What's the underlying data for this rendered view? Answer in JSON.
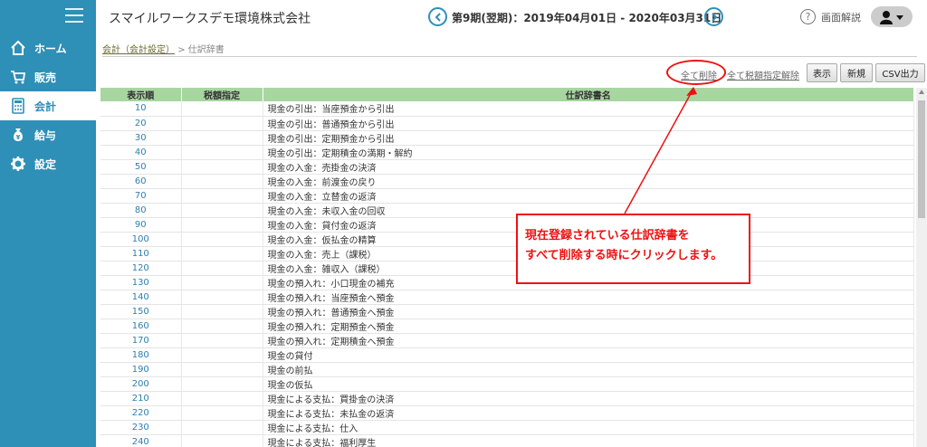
{
  "sidebar": {
    "items": [
      {
        "label": "ホーム",
        "icon": "home-icon"
      },
      {
        "label": "販売",
        "icon": "cart-icon"
      },
      {
        "label": "会計",
        "icon": "calculator-icon",
        "active": true
      },
      {
        "label": "給与",
        "icon": "money-bag-icon"
      },
      {
        "label": "設定",
        "icon": "gear-icon"
      }
    ]
  },
  "header": {
    "company": "スマイルワークスデモ環境株式会社",
    "period": "第9期(翌期)：2019年04月01日 - 2020年03月31日",
    "help_label": "画面解説",
    "help_icon": "?"
  },
  "breadcrumb": {
    "parent": "会計（会計設定）",
    "separator": ">",
    "current": "仕訳辞書"
  },
  "toolbar": {
    "delete_all": "全て削除",
    "clear_tax": "全て税額指定解除",
    "show_button": "表示",
    "new_button": "新規",
    "csv_button": "CSV出力"
  },
  "table": {
    "headers": [
      "表示順",
      "税額指定",
      "仕訳辞書名"
    ],
    "rows": [
      {
        "order": "10",
        "tax": "",
        "name": "現金の引出：当座預金から引出"
      },
      {
        "order": "20",
        "tax": "",
        "name": "現金の引出：普通預金から引出"
      },
      {
        "order": "30",
        "tax": "",
        "name": "現金の引出：定期預金から引出"
      },
      {
        "order": "40",
        "tax": "",
        "name": "現金の引出：定期積金の満期・解約"
      },
      {
        "order": "50",
        "tax": "",
        "name": "現金の入金：売掛金の決済"
      },
      {
        "order": "60",
        "tax": "",
        "name": "現金の入金：前渡金の戻り"
      },
      {
        "order": "70",
        "tax": "",
        "name": "現金の入金：立替金の返済"
      },
      {
        "order": "80",
        "tax": "",
        "name": "現金の入金：未収入金の回収"
      },
      {
        "order": "90",
        "tax": "",
        "name": "現金の入金：貸付金の返済"
      },
      {
        "order": "100",
        "tax": "",
        "name": "現金の入金：仮払金の精算"
      },
      {
        "order": "110",
        "tax": "",
        "name": "現金の入金：売上（課税）"
      },
      {
        "order": "120",
        "tax": "",
        "name": "現金の入金：雑収入（課税）"
      },
      {
        "order": "130",
        "tax": "",
        "name": "現金の預入れ：小口現金の補充"
      },
      {
        "order": "140",
        "tax": "",
        "name": "現金の預入れ：当座預金へ預金"
      },
      {
        "order": "150",
        "tax": "",
        "name": "現金の預入れ：普通預金へ預金"
      },
      {
        "order": "160",
        "tax": "",
        "name": "現金の預入れ：定期預金へ預金"
      },
      {
        "order": "170",
        "tax": "",
        "name": "現金の預入れ：定期積金へ預金"
      },
      {
        "order": "180",
        "tax": "",
        "name": "現金の貸付"
      },
      {
        "order": "190",
        "tax": "",
        "name": "現金の前払"
      },
      {
        "order": "200",
        "tax": "",
        "name": "現金の仮払"
      },
      {
        "order": "210",
        "tax": "",
        "name": "現金による支払：買掛金の決済"
      },
      {
        "order": "220",
        "tax": "",
        "name": "現金による支払：未払金の返済"
      },
      {
        "order": "230",
        "tax": "",
        "name": "現金による支払：仕入"
      },
      {
        "order": "240",
        "tax": "",
        "name": "現金による支払：福利厚生"
      }
    ]
  },
  "annotation": {
    "line1": "現在登録されている仕訳辞書を",
    "line2": "すべて削除する時にクリックします。"
  },
  "colors": {
    "sidebar": "#2e8fb7",
    "table_header": "#a8d6a1",
    "annotation": "#e11111",
    "link": "#2e7fb0"
  }
}
